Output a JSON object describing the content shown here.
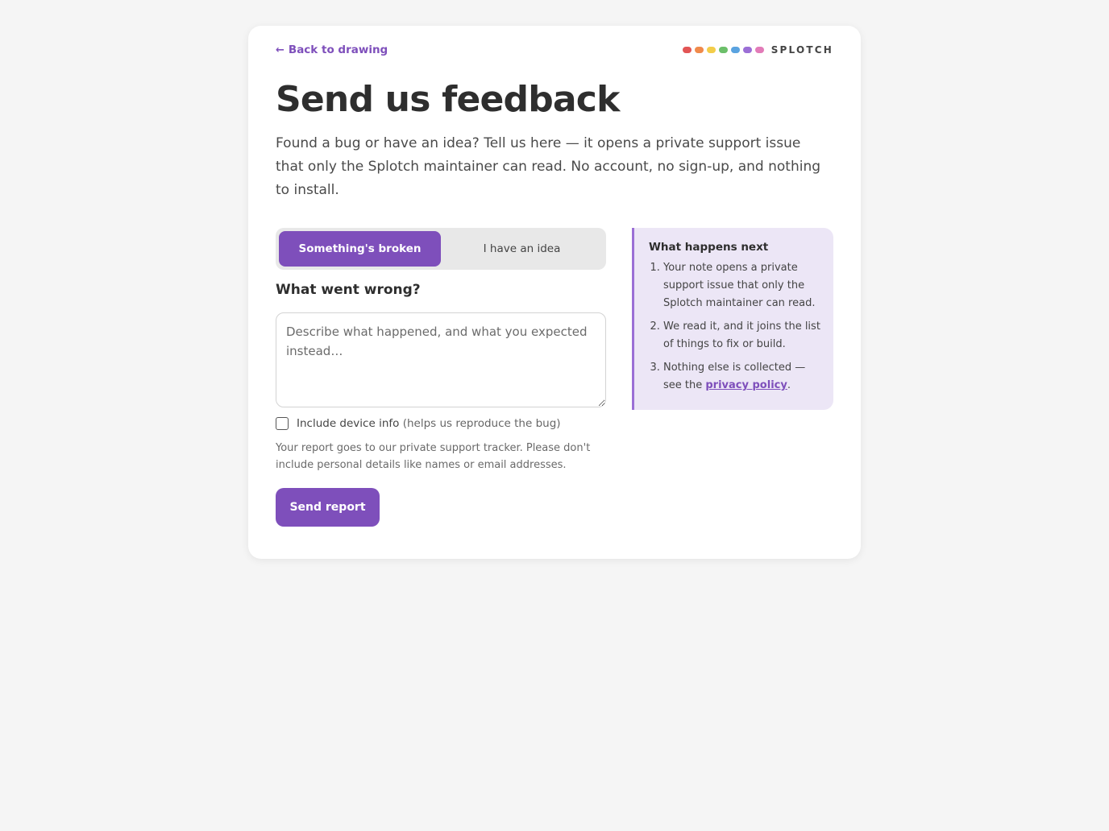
{
  "nav": {
    "back_arrow": "←",
    "back_label": "Back to drawing"
  },
  "brand": {
    "name": "SPLOTCH",
    "dot_colors": [
      "#e25555",
      "#f08a4b",
      "#f3cd4a",
      "#6cbf6a",
      "#5aa3e0",
      "#9b6fd6",
      "#e27bb8"
    ]
  },
  "header": {
    "title": "Send us feedback",
    "lead": "Found a bug or have an idea? Tell us here — it opens a private support issue that only the Splotch maintainer can read. No account, no sign-up, and nothing to install."
  },
  "tabs": {
    "broken_label": "Something's broken",
    "idea_label": "I have an idea",
    "selected": "broken"
  },
  "form": {
    "question": "What went wrong?",
    "textarea_value": "",
    "textarea_placeholder": "Describe what happened, and what you expected instead…",
    "checkbox_label": "Include device info",
    "checkbox_hint": "(helps us reproduce the bug)",
    "checkbox_checked": false,
    "notice": "Your report goes to our private support tracker. Please don't include personal details like names or email addresses.",
    "submit_label": "Send report"
  },
  "aside": {
    "title": "What happens next",
    "step1": "Your note opens a private support issue that only the Splotch maintainer can read.",
    "step2": "We read it, and it joins the list of things to fix or build.",
    "step3_prefix": "Nothing else is collected — see the ",
    "step3_link": "privacy policy",
    "step3_suffix": "."
  },
  "colors": {
    "page_bg": "#f5f5f5",
    "accent": "#7e4fbb",
    "aside_bg": "#ece6f6",
    "aside_border": "#9b6fd6"
  }
}
